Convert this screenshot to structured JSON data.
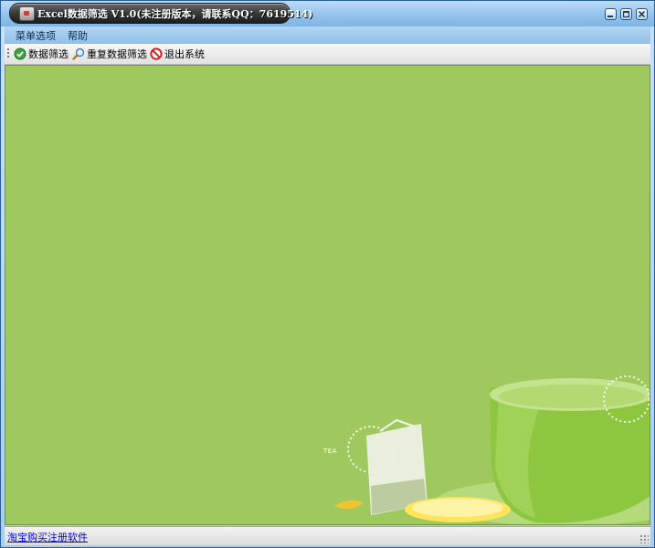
{
  "window": {
    "title": "Excel数据筛选 V1.0(未注册版本，请联系QQ：7619514)"
  },
  "controls": {
    "minimize_icon": "minimize-icon",
    "maximize_icon": "maximize-icon",
    "close_icon": "close-icon"
  },
  "menu": {
    "items": [
      {
        "label": "菜单选项"
      },
      {
        "label": "帮助"
      }
    ]
  },
  "toolbar": {
    "buttons": [
      {
        "label": "数据筛选",
        "icon": "check-circle-icon"
      },
      {
        "label": "重复数据筛选",
        "icon": "magnifier-icon"
      },
      {
        "label": "退出系统",
        "icon": "no-entry-icon"
      }
    ]
  },
  "background": {
    "tea_tag": "TEA"
  },
  "statusbar": {
    "link": "淘宝购买注册软件"
  },
  "colors": {
    "background_green": "#9fc95e",
    "titlebar_blue": "#94c3ec",
    "link_blue": "#0000ee"
  }
}
